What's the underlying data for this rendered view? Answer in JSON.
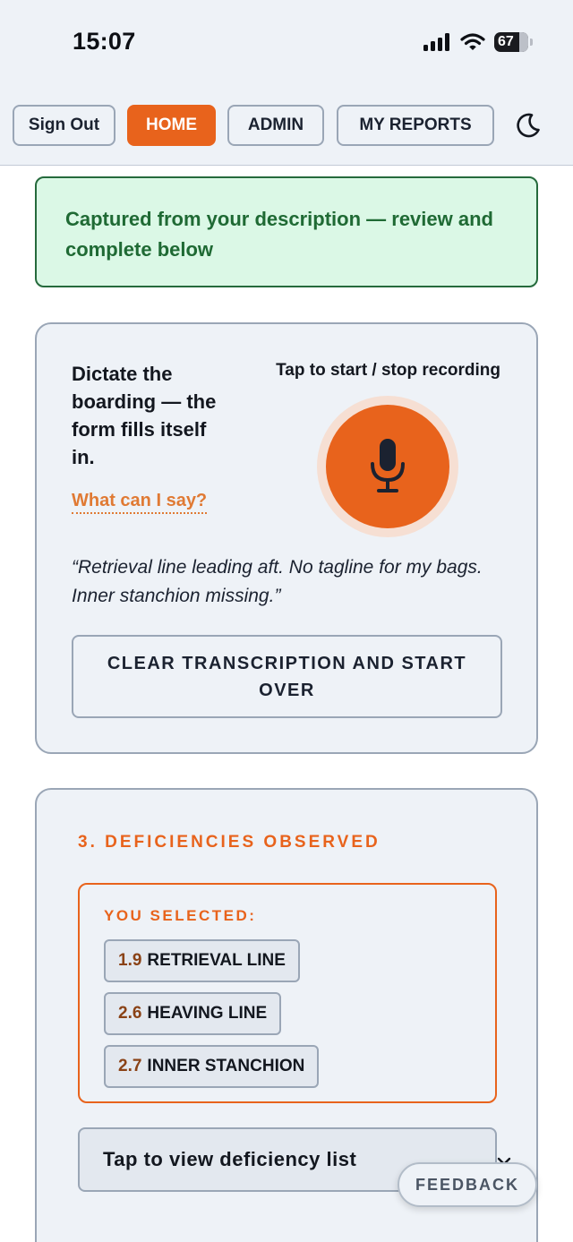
{
  "status_bar": {
    "time": "15:07",
    "battery": "67"
  },
  "nav": {
    "sign_out": "Sign Out",
    "home": "HOME",
    "admin": "ADMIN",
    "my_reports": "MY REPORTS"
  },
  "banner": {
    "text": "Captured from your description — review and complete below"
  },
  "dictation": {
    "heading": "Dictate the boarding — the form fills itself in.",
    "help_link": "What can I say?",
    "tap_label": "Tap to start / stop recording",
    "transcript": "“Retrieval line leading aft. No tagline for my bags. Inner stanchion missing.”",
    "clear_button": "CLEAR TRANSCRIPTION AND START OVER"
  },
  "deficiencies": {
    "title": "3. DEFICIENCIES OBSERVED",
    "selected_label": "YOU SELECTED:",
    "items": [
      {
        "code": "1.9",
        "label": "RETRIEVAL LINE"
      },
      {
        "code": "2.6",
        "label": "HEAVING LINE"
      },
      {
        "code": "2.7",
        "label": "INNER STANCHION"
      }
    ],
    "dropdown_label": "Tap to view deficiency list"
  },
  "feedback": {
    "label": "FEEDBACK"
  },
  "colors": {
    "accent": "#e8631c",
    "success": "#1f6a34",
    "success_bg": "#dbf8e6",
    "surface": "#eef2f7"
  }
}
